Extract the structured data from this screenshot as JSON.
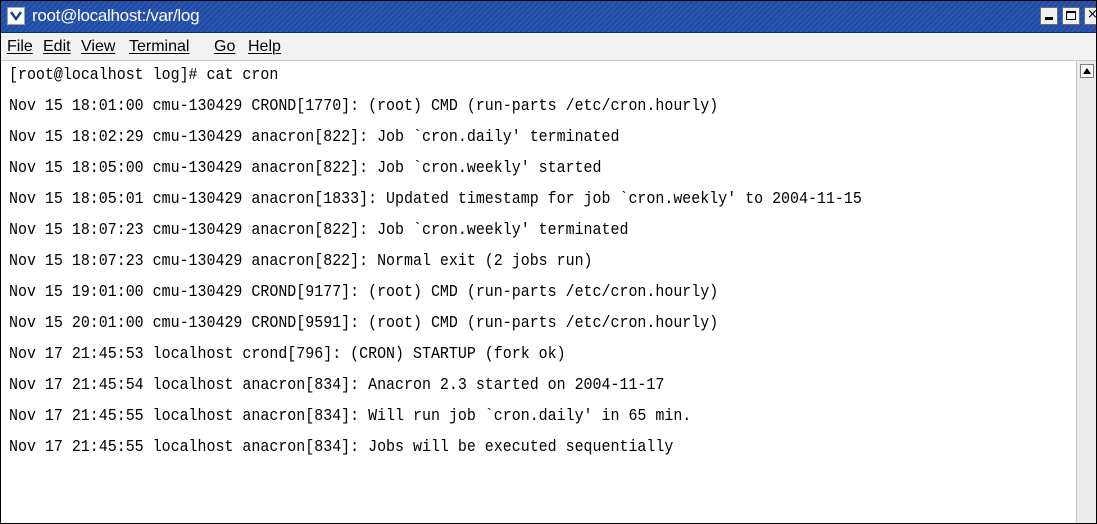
{
  "window": {
    "title": "root@localhost:/var/log",
    "controls": {
      "minimize": "minimize",
      "maximize": "maximize",
      "close": "×"
    }
  },
  "menu": {
    "file": "File",
    "edit": "Edit",
    "view": "View",
    "terminal": "Terminal",
    "go": "Go",
    "help": "Help"
  },
  "terminal": {
    "lines": [
      "[root@localhost log]# cat cron",
      "Nov 15 18:01:00 cmu-130429 CROND[1770]: (root) CMD (run-parts /etc/cron.hourly)",
      "Nov 15 18:02:29 cmu-130429 anacron[822]: Job `cron.daily' terminated",
      "Nov 15 18:05:00 cmu-130429 anacron[822]: Job `cron.weekly' started",
      "Nov 15 18:05:01 cmu-130429 anacron[1833]: Updated timestamp for job `cron.weekly' to 2004-11-15",
      "Nov 15 18:07:23 cmu-130429 anacron[822]: Job `cron.weekly' terminated",
      "Nov 15 18:07:23 cmu-130429 anacron[822]: Normal exit (2 jobs run)",
      "Nov 15 19:01:00 cmu-130429 CROND[9177]: (root) CMD (run-parts /etc/cron.hourly)",
      "Nov 15 20:01:00 cmu-130429 CROND[9591]: (root) CMD (run-parts /etc/cron.hourly)",
      "Nov 17 21:45:53 localhost crond[796]: (CRON) STARTUP (fork ok)",
      "Nov 17 21:45:54 localhost anacron[834]: Anacron 2.3 started on 2004-11-17",
      "Nov 17 21:45:55 localhost anacron[834]: Will run job `cron.daily' in 65 min.",
      "Nov 17 21:45:55 localhost anacron[834]: Jobs will be executed sequentially"
    ]
  },
  "colors": {
    "titlebar": "#2c58b3",
    "menubar": "#f2f2f2",
    "terminal_bg": "#ffffff",
    "terminal_fg": "#000000"
  }
}
